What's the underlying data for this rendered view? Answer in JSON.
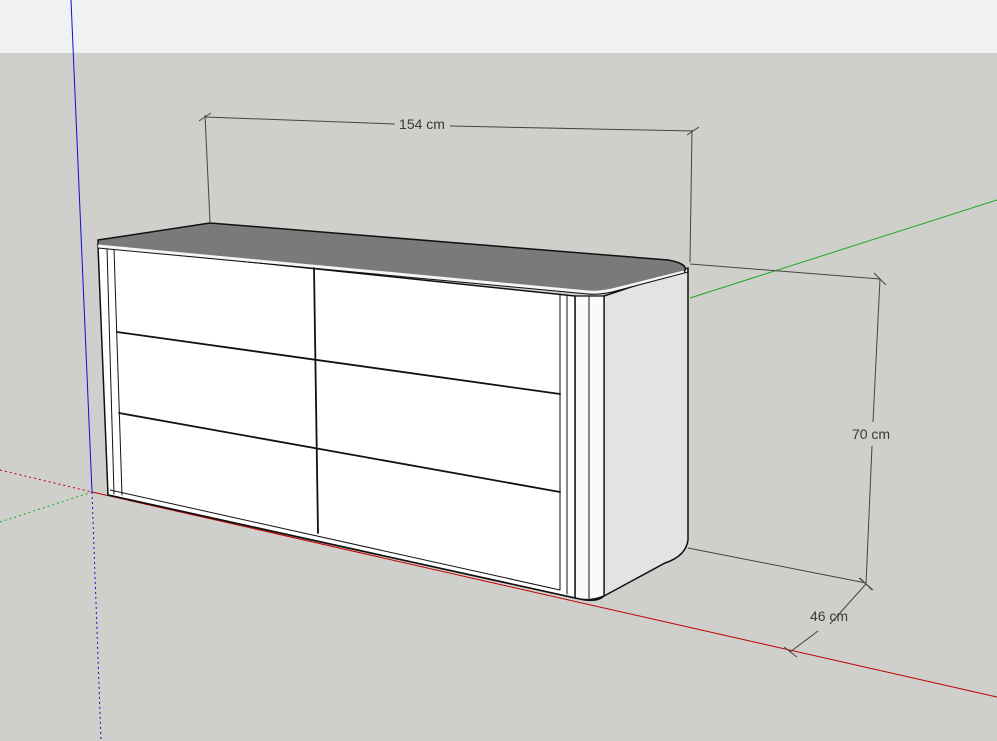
{
  "scene": {
    "colors": {
      "sky": "#eff1f3",
      "ground": "#cfcfcb",
      "red_axis": "#c00000",
      "green_axis": "#1fa81f",
      "blue_axis": "#1010d0",
      "top_surface": "#7a7a7a",
      "front_face": "#ffffff",
      "side_face": "#e3e3e3"
    },
    "object": "dresser-six-drawers",
    "drawer_count": 6
  },
  "dimensions": {
    "width": "154 cm",
    "height": "70 cm",
    "depth": "46 cm"
  }
}
